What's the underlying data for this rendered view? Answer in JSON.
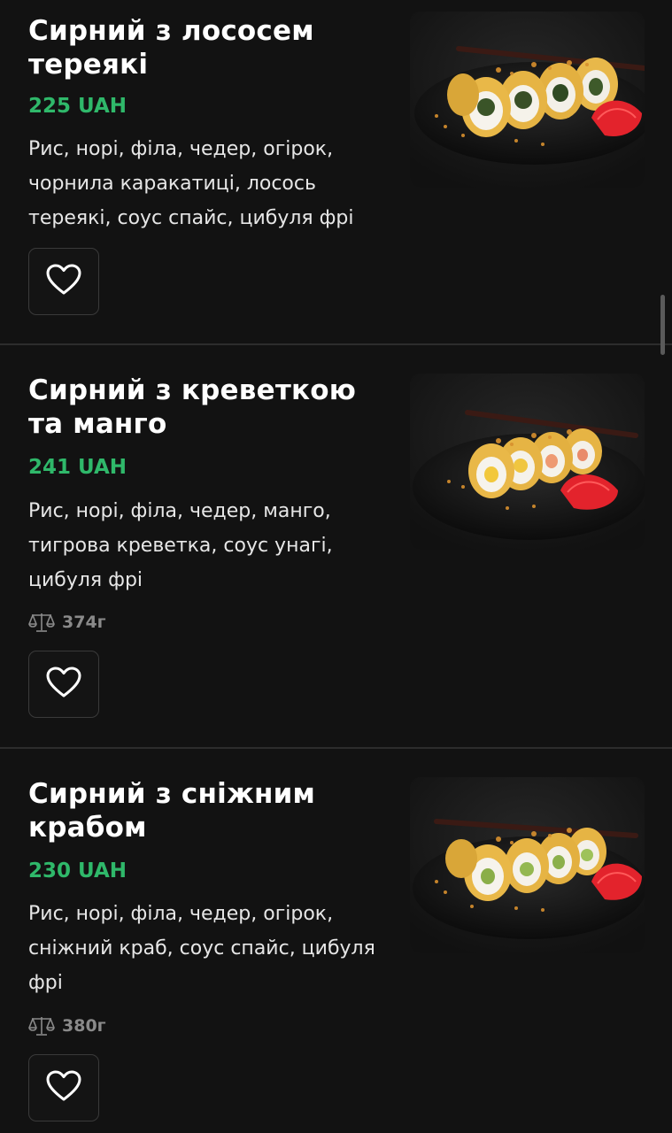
{
  "items": [
    {
      "title_line1": "Сирний з лососем",
      "title_line2": "тереякі",
      "price": "225 UAH",
      "desc_line1": "Рис, норі, філа, чедер, огірок,",
      "desc_line2": "чорнила каракатиці, лосось",
      "desc_line3": "тереякі, соус спайс, цибуля фрі",
      "image_alt": "sushi-roll-salmon-teriyaki"
    },
    {
      "title_line1": "Сирний з креветкою",
      "title_line2": "та манго",
      "price": "241 UAH",
      "desc_line1": "Рис, норі, філа, чедер, манго,",
      "desc_line2": "тигрова креветка, соус унагі,",
      "desc_line3": "цибуля фрі",
      "weight": "374г",
      "image_alt": "sushi-roll-shrimp-mango"
    },
    {
      "title_line1": "Сирний з сніжним",
      "title_line2": "крабом",
      "price": "230 UAH",
      "desc_line1": "Рис, норі, філа, чедер, огірок,",
      "desc_line2": "сніжний краб, соус спайс, цибуля",
      "desc_line3": "фрі",
      "weight": "380г",
      "image_alt": "sushi-roll-snow-crab"
    }
  ],
  "icons": {
    "favorite": "heart-icon",
    "weight": "scale-icon"
  },
  "colors": {
    "background": "#121212",
    "price": "#2fb86a",
    "text": "#ffffff",
    "muted": "#8a8a8a"
  }
}
